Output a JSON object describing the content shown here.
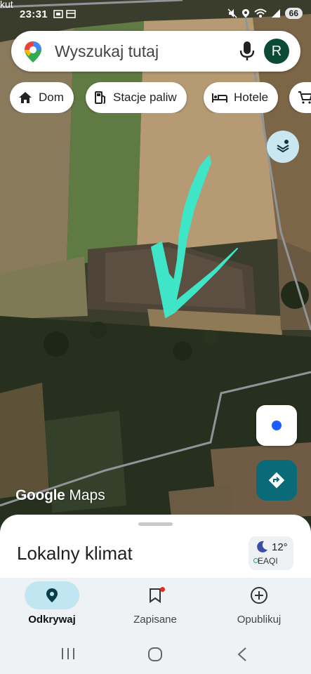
{
  "status_bar": {
    "carrier": "kut",
    "time": "23:31",
    "battery": "66"
  },
  "search": {
    "placeholder": "Wyszukaj tutaj",
    "avatar_letter": "R"
  },
  "chips": [
    {
      "label": "Dom",
      "icon": "home-icon"
    },
    {
      "label": "Stacje paliw",
      "icon": "gas-station-icon"
    },
    {
      "label": "Hotele",
      "icon": "bed-icon"
    },
    {
      "label": "",
      "icon": "cart-icon"
    }
  ],
  "map": {
    "watermark_brand": "Google",
    "watermark_product": "Maps",
    "annotation_color": "#3fe5c7"
  },
  "sheet": {
    "title": "Lokalny klimat",
    "temperature": "12°",
    "air_quality": "EAQI"
  },
  "nav": [
    {
      "label": "Odkrywaj",
      "icon": "explore-pin-icon",
      "active": true
    },
    {
      "label": "Zapisane",
      "icon": "bookmark-icon",
      "active": false
    },
    {
      "label": "Opublikuj",
      "icon": "add-circle-icon",
      "active": false
    }
  ],
  "colors": {
    "accent": "#0a6a78",
    "active_pill": "#bfe6f1",
    "avatar": "#0b4a34"
  }
}
